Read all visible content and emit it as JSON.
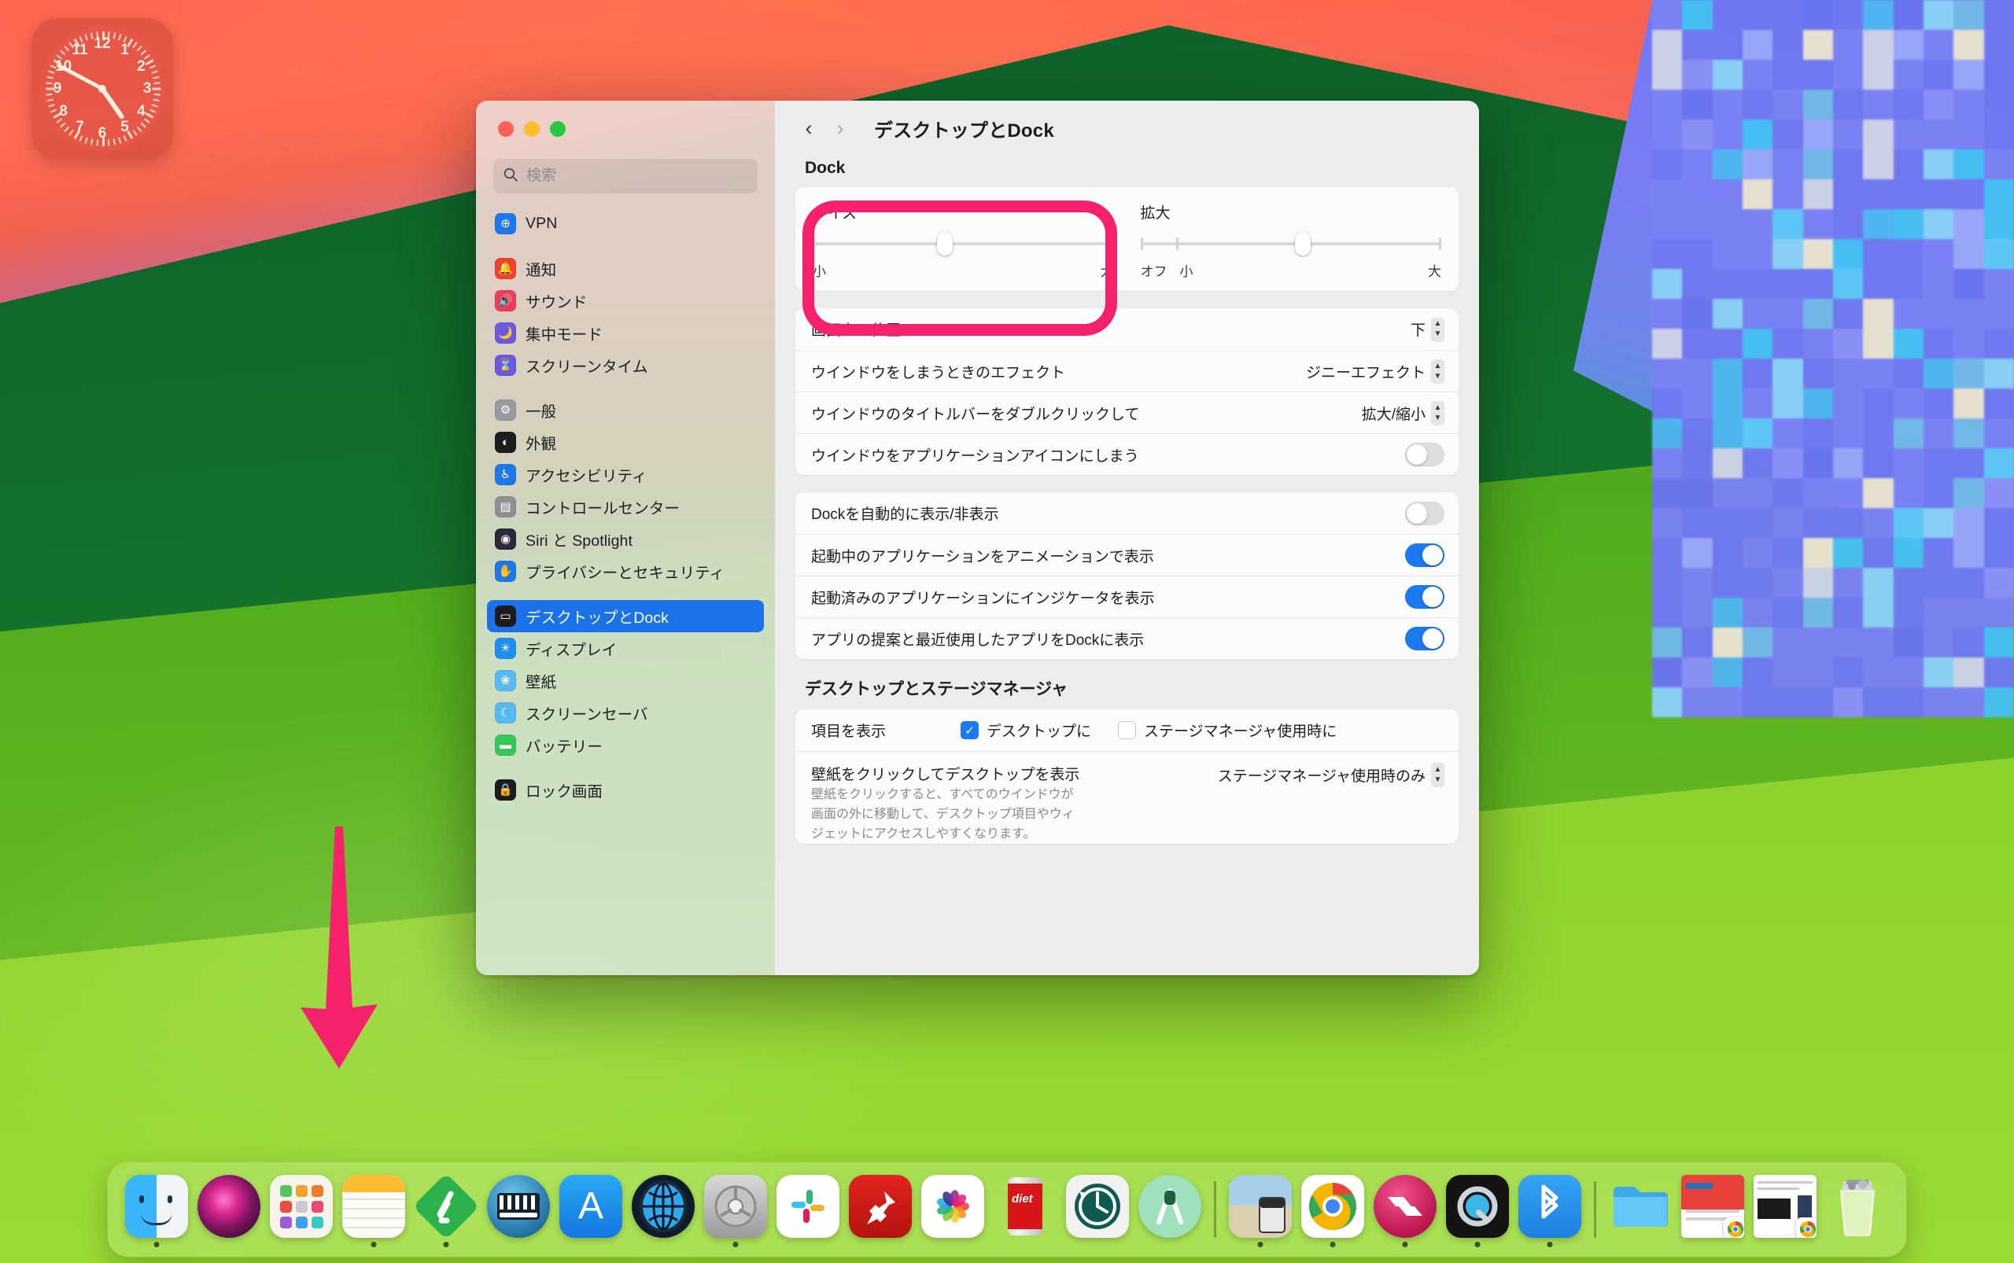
{
  "window": {
    "title": "デスクトップとDock",
    "traffic_lights": [
      "close",
      "minimize",
      "maximize"
    ],
    "nav": {
      "back": "‹",
      "forward": "›"
    }
  },
  "search": {
    "placeholder": "検索",
    "value": ""
  },
  "sidebar": {
    "groups": [
      {
        "items": [
          {
            "label": "VPN",
            "icon": "vpn-icon",
            "color": "#1e78ea",
            "glyph": "⊕",
            "selected": false
          }
        ]
      },
      {
        "items": [
          {
            "label": "通知",
            "icon": "notifications-icon",
            "color": "#f1412f",
            "glyph": "🔔",
            "selected": false
          },
          {
            "label": "サウンド",
            "icon": "sound-icon",
            "color": "#f03b5a",
            "glyph": "🔊",
            "selected": false
          },
          {
            "label": "集中モード",
            "icon": "focus-icon",
            "color": "#6a5ae0",
            "glyph": "🌙",
            "selected": false
          },
          {
            "label": "スクリーンタイム",
            "icon": "screen-time-icon",
            "color": "#6a5ae0",
            "glyph": "⌛",
            "selected": false
          }
        ]
      },
      {
        "items": [
          {
            "label": "一般",
            "icon": "general-icon",
            "color": "#9a9a9e",
            "glyph": "⚙",
            "selected": false
          },
          {
            "label": "外観",
            "icon": "appearance-icon",
            "color": "#1c1c1e",
            "glyph": "◐",
            "selected": false
          },
          {
            "label": "アクセシビリティ",
            "icon": "accessibility-icon",
            "color": "#1e78ea",
            "glyph": "♿",
            "selected": false
          },
          {
            "label": "コントロールセンター",
            "icon": "control-center-icon",
            "color": "#8e8e93",
            "glyph": "▤",
            "selected": false
          },
          {
            "label": "Siri と Spotlight",
            "icon": "siri-spotlight-icon",
            "color": "#2a2a3c",
            "glyph": "◉",
            "selected": false
          },
          {
            "label": "プライバシーとセキュリティ",
            "icon": "privacy-security-icon",
            "color": "#1e78ea",
            "glyph": "✋",
            "selected": false
          }
        ]
      },
      {
        "items": [
          {
            "label": "デスクトップとDock",
            "icon": "desktop-dock-icon",
            "color": "#1c1c1e",
            "glyph": "▭",
            "selected": true
          },
          {
            "label": "ディスプレイ",
            "icon": "display-icon",
            "color": "#1e8ff0",
            "glyph": "☀",
            "selected": false
          },
          {
            "label": "壁紙",
            "icon": "wallpaper-icon",
            "color": "#57b9ef",
            "glyph": "❀",
            "selected": false
          },
          {
            "label": "スクリーンセーバ",
            "icon": "screensaver-icon",
            "color": "#57b9ef",
            "glyph": "☾",
            "selected": false
          },
          {
            "label": "バッテリー",
            "icon": "battery-icon",
            "color": "#35c759",
            "glyph": "▬",
            "selected": false
          }
        ]
      },
      {
        "items": [
          {
            "label": "ロック画面",
            "icon": "lock-screen-icon",
            "color": "#1c1c1e",
            "glyph": "🔒",
            "selected": false
          }
        ]
      }
    ]
  },
  "main": {
    "dock_section": {
      "heading": "Dock",
      "size_slider": {
        "title": "サイズ",
        "min_label": "小",
        "max_label": "大",
        "value_percent": 44
      },
      "magnification_slider": {
        "title": "拡大",
        "off_label": "オフ",
        "min_label": "小",
        "max_label": "大",
        "value_percent": 54
      },
      "rows": [
        {
          "label": "画面上の位置",
          "control": "popup",
          "value": "下"
        },
        {
          "label": "ウインドウをしまうときのエフェクト",
          "control": "popup",
          "value": "ジニーエフェクト"
        },
        {
          "label": "ウインドウのタイトルバーをダブルクリックして",
          "control": "popup",
          "value": "拡大/縮小"
        },
        {
          "label": "ウインドウをアプリケーションアイコンにしまう",
          "control": "toggle",
          "value": "off"
        }
      ],
      "rows2": [
        {
          "label": "Dockを自動的に表示/非表示",
          "control": "toggle",
          "value": "off"
        },
        {
          "label": "起動中のアプリケーションをアニメーションで表示",
          "control": "toggle",
          "value": "on"
        },
        {
          "label": "起動済みのアプリケーションにインジケータを表示",
          "control": "toggle",
          "value": "on"
        },
        {
          "label": "アプリの提案と最近使用したアプリをDockに表示",
          "control": "toggle",
          "value": "on"
        }
      ]
    },
    "stage_section": {
      "heading": "デスクトップとステージマネージャ",
      "show_items": {
        "label": "項目を表示",
        "checkbox_desktop": {
          "text": "デスクトップに",
          "checked": true
        },
        "checkbox_stage": {
          "text": "ステージマネージャ使用時に",
          "checked": false
        }
      },
      "click_wallpaper": {
        "label": "壁紙をクリックしてデスクトップを表示",
        "value": "ステージマネージャ使用時のみ",
        "description_line1": "壁紙をクリックすると、すべてのウインドウが",
        "description_line2": "画面の外に移動して、デスクトップ項目やウィ",
        "description_line3": "ジェットにアクセスしやすくなります。"
      }
    }
  },
  "annotations": {
    "highlight_box": {
      "target": "size-slider",
      "color": "#f5226b"
    },
    "arrow": {
      "direction": "down",
      "target": "dock",
      "color": "#f5226b"
    }
  },
  "widgets": {
    "clock": {
      "name": "clock-widget",
      "numbers": [
        "12",
        "1",
        "2",
        "3",
        "4",
        "5",
        "6",
        "7",
        "8",
        "9",
        "10",
        "11"
      ]
    }
  },
  "dock": {
    "items": [
      {
        "name": "finder",
        "running": true,
        "kind": "finder"
      },
      {
        "name": "siri",
        "running": false,
        "kind": "siri"
      },
      {
        "name": "launchpad",
        "running": false,
        "kind": "launchpad"
      },
      {
        "name": "notes",
        "running": true,
        "kind": "notes"
      },
      {
        "name": "feedly",
        "running": true,
        "kind": "feedly"
      },
      {
        "name": "keyboard-maestro",
        "running": false,
        "kind": "keyboard"
      },
      {
        "name": "app-store",
        "running": false,
        "kind": "appstore"
      },
      {
        "name": "browser-globe",
        "running": false,
        "kind": "globe"
      },
      {
        "name": "system-settings",
        "running": true,
        "kind": "settings"
      },
      {
        "name": "slack",
        "running": false,
        "kind": "slack"
      },
      {
        "name": "pinboard",
        "running": false,
        "kind": "pin"
      },
      {
        "name": "photos",
        "running": false,
        "kind": "photos"
      },
      {
        "name": "jpegmini",
        "running": false,
        "kind": "jpegmini"
      },
      {
        "name": "time-machine",
        "running": false,
        "kind": "timemachine"
      },
      {
        "name": "android-studio",
        "running": false,
        "kind": "android"
      }
    ],
    "items2": [
      {
        "name": "preview",
        "running": true,
        "kind": "preview"
      },
      {
        "name": "google-chrome",
        "running": true,
        "kind": "chrome"
      },
      {
        "name": "transmit",
        "running": true,
        "kind": "transmit"
      },
      {
        "name": "quicktime",
        "running": true,
        "kind": "quicktime"
      },
      {
        "name": "bluetooth",
        "running": true,
        "kind": "bluetooth"
      }
    ],
    "items3": [
      {
        "name": "downloads-folder",
        "running": false,
        "kind": "folder"
      },
      {
        "name": "chrome-window-1",
        "running": false,
        "kind": "minwin1"
      },
      {
        "name": "chrome-window-2",
        "running": false,
        "kind": "minwin2"
      },
      {
        "name": "trash",
        "running": false,
        "kind": "trash"
      }
    ]
  }
}
